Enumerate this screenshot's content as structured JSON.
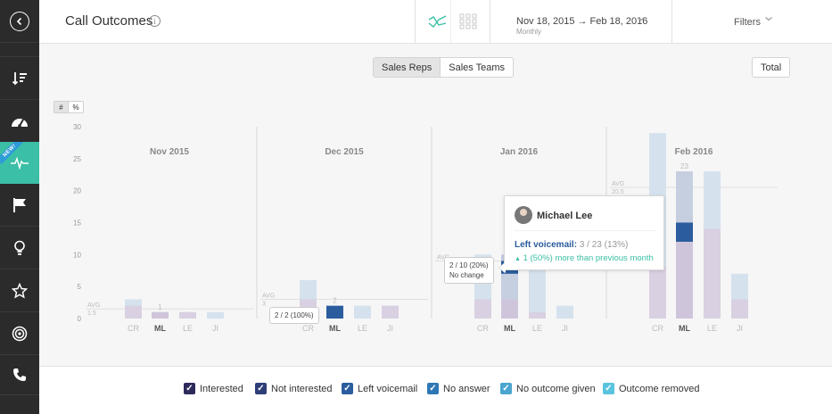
{
  "header": {
    "title": "Call Outcomes",
    "info_glyph": "i",
    "date_range": "Nov 18, 2015 → Feb 18, 2016",
    "date_granularity": "Monthly",
    "filters_label": "Filters"
  },
  "sidebar": {
    "new_badge": "NEW!",
    "items": [
      {
        "icon": "back-icon"
      },
      {
        "icon": "sort-icon"
      },
      {
        "icon": "dashboard-icon"
      },
      {
        "icon": "pulse-icon",
        "active": true
      },
      {
        "icon": "flag-icon"
      },
      {
        "icon": "lightbulb-icon"
      },
      {
        "icon": "star-icon"
      },
      {
        "icon": "target-icon"
      },
      {
        "icon": "phone-icon"
      }
    ]
  },
  "toolbar": {
    "tab_reps": "Sales Reps",
    "tab_teams": "Sales Teams",
    "total_label": "Total",
    "unit_count": "#",
    "unit_percent": "%"
  },
  "colors": {
    "interested": "#2e2a5c",
    "not_interested": "#2e3e78",
    "left_voicemail": "#2b5d9e",
    "no_answer": "#2f77b4",
    "no_outcome_given": "#4aa6cf",
    "outcome_removed": "#5ac4de",
    "accent": "#3bbfa6",
    "sidebar_bg": "#2b2b2b"
  },
  "chart_data": {
    "type": "bar",
    "stacked": true,
    "ylim": [
      0,
      30
    ],
    "yticks": [
      0,
      5,
      10,
      15,
      20,
      25,
      30
    ],
    "groups": [
      {
        "month": "Nov 2015",
        "reps": [
          "CR",
          "ML",
          "LE",
          "JI"
        ],
        "avg": 1.5,
        "avg_label": "AVG",
        "avg_value": "1.5",
        "totals": [
          3,
          1,
          1,
          1
        ],
        "bottom": [
          2,
          1,
          1,
          0
        ],
        "top_label": "1"
      },
      {
        "month": "Dec 2015",
        "reps": [
          "CR",
          "ML",
          "LE",
          "JI"
        ],
        "avg": 3,
        "avg_label": "AVG",
        "avg_value": "3",
        "totals": [
          6,
          2,
          2,
          2
        ],
        "bottom": [
          3,
          0,
          0,
          2
        ],
        "highlight_rep": 1,
        "highlight_value": 2,
        "top_label": "2"
      },
      {
        "month": "Jan 2016",
        "reps": [
          "CR",
          "ML",
          "LE",
          "JI"
        ],
        "avg": 9,
        "avg_label": "AVG",
        "avg_value": "",
        "totals": [
          10,
          10,
          8,
          2
        ],
        "bottom": [
          3,
          3,
          1,
          0
        ],
        "highlight_rep": 1,
        "highlight_value": 2,
        "top_label": ""
      },
      {
        "month": "Feb 2016",
        "reps": [
          "CR",
          "ML",
          "LE",
          "JI"
        ],
        "avg": 20.5,
        "avg_label": "AVG",
        "avg_value": "20.5",
        "totals": [
          29,
          23,
          23,
          7
        ],
        "bottom": [
          8,
          12,
          14,
          3
        ],
        "highlight_rep": 1,
        "highlight_value": 3,
        "top_label": "23"
      }
    ],
    "selected_rep": "ML"
  },
  "tooltip": {
    "name": "Michael Lee",
    "metric_label": "Left voicemail:",
    "metric_value": "3 / 23 (13%)",
    "change_glyph": "▲",
    "change_text": "1 (50%) more than previous month"
  },
  "callouts": {
    "dec": "2 / 2 (100%)",
    "jan_value": "2 / 10 (20%)",
    "jan_change": "No change"
  },
  "legend": [
    {
      "label": "Interested",
      "color": "#2e2a5c"
    },
    {
      "label": "Not interested",
      "color": "#2e3e78"
    },
    {
      "label": "Left voicemail",
      "color": "#2b5d9e"
    },
    {
      "label": "No answer",
      "color": "#2f77b4"
    },
    {
      "label": "No outcome given",
      "color": "#4aa6cf"
    },
    {
      "label": "Outcome removed",
      "color": "#5ac4de"
    }
  ]
}
